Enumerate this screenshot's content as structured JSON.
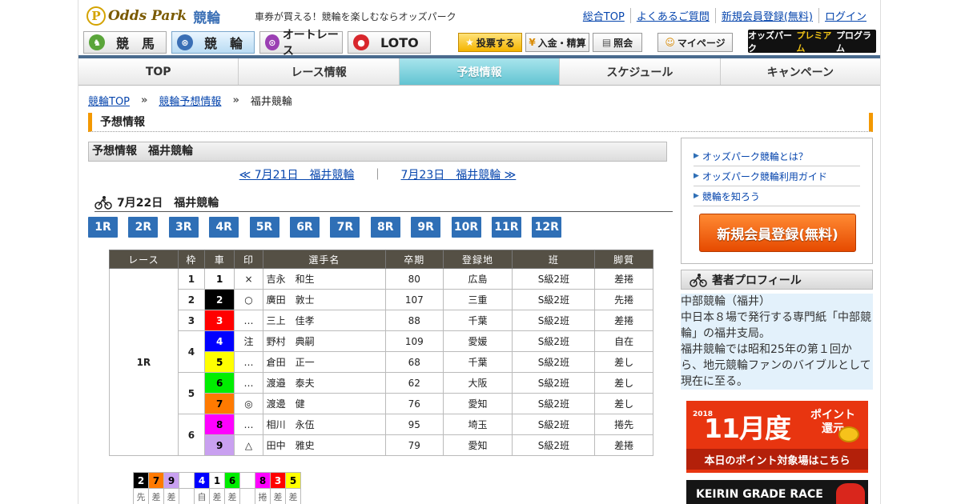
{
  "header": {
    "logo_text": "Odds Park",
    "logo_sub": "競輪",
    "tagline": "車券が買える！競輪を楽しむならオッズパーク",
    "links": [
      "総合TOP",
      "よくあるご質問",
      "新規会員登録(無料)",
      "ログイン"
    ]
  },
  "sports": [
    {
      "label": "競　馬"
    },
    {
      "label": "競　輪"
    },
    {
      "label": "オートレース"
    },
    {
      "label": "LOTO"
    }
  ],
  "user_buttons": {
    "vote": "投票する",
    "deposit": "入金・精算",
    "inquiry": "照会",
    "mypage": "マイページ"
  },
  "premium": {
    "pre": "オッズパーク",
    "mid": "プレミアム",
    "post": "プログラム"
  },
  "gnav": [
    "TOP",
    "レース情報",
    "予想情報",
    "スケジュール",
    "キャンペーン"
  ],
  "breadcrumb": {
    "items": [
      "競輪TOP",
      "競輪予想情報"
    ],
    "current": "福井競輪",
    "sep": "»"
  },
  "section_title": "予想情報",
  "subhead": "予想情報　福井競輪",
  "daynav": {
    "prev": "≪ 7月21日　福井競輪",
    "sep": "｜",
    "next": "7月23日　福井競輪 ≫"
  },
  "date_title": "7月22日　福井競輪",
  "race_tabs": [
    "1R",
    "2R",
    "3R",
    "4R",
    "5R",
    "6R",
    "7R",
    "8R",
    "9R",
    "10R",
    "11R",
    "12R"
  ],
  "table": {
    "headers": [
      "レース",
      "枠",
      "車",
      "印",
      "選手名",
      "卒期",
      "登録地",
      "班",
      "脚質"
    ],
    "race": "1R",
    "rows": [
      {
        "waku": "1",
        "car": "1",
        "mark": "×",
        "name": "吉永　和生",
        "term": "80",
        "pref": "広島",
        "class": "S級2班",
        "style": "差捲",
        "bg": "#ffffff",
        "fg": "#000000"
      },
      {
        "waku": "2",
        "car": "2",
        "mark": "○",
        "name": "廣田　敦士",
        "term": "107",
        "pref": "三重",
        "class": "S級2班",
        "style": "先捲",
        "bg": "#000000",
        "fg": "#ffffff"
      },
      {
        "waku": "3",
        "car": "3",
        "mark": "…",
        "name": "三上　佳孝",
        "term": "88",
        "pref": "千葉",
        "class": "S級2班",
        "style": "差捲",
        "bg": "#ff0000",
        "fg": "#ffffff"
      },
      {
        "waku": "4",
        "car": "4",
        "mark": "注",
        "name": "野村　典嗣",
        "term": "109",
        "pref": "愛媛",
        "class": "S級2班",
        "style": "自在",
        "bg": "#0000ff",
        "fg": "#ffffff"
      },
      {
        "waku": "",
        "car": "5",
        "mark": "…",
        "name": "倉田　正一",
        "term": "68",
        "pref": "千葉",
        "class": "S級2班",
        "style": "差し",
        "bg": "#ffff00",
        "fg": "#000000"
      },
      {
        "waku": "5",
        "car": "6",
        "mark": "…",
        "name": "渡邉　泰夫",
        "term": "62",
        "pref": "大阪",
        "class": "S級2班",
        "style": "差し",
        "bg": "#00ee00",
        "fg": "#000000"
      },
      {
        "waku": "",
        "car": "7",
        "mark": "◎",
        "name": "渡邊　健",
        "term": "76",
        "pref": "愛知",
        "class": "S級2班",
        "style": "差し",
        "bg": "#ff7a00",
        "fg": "#000000"
      },
      {
        "waku": "6",
        "car": "8",
        "mark": "…",
        "name": "相川　永伍",
        "term": "95",
        "pref": "埼玉",
        "class": "S級2班",
        "style": "捲先",
        "bg": "#ff00ff",
        "fg": "#000000"
      },
      {
        "waku": "",
        "car": "9",
        "mark": "△",
        "name": "田中　雅史",
        "term": "79",
        "pref": "愛知",
        "class": "S級2班",
        "style": "差捲",
        "bg": "#c9a0f0",
        "fg": "#000000"
      }
    ]
  },
  "line_cells": [
    {
      "car": "2",
      "bg": "#000000",
      "fg": "#ffffff",
      "s": "先"
    },
    {
      "car": "7",
      "bg": "#ff7a00",
      "fg": "#000000",
      "s": "差"
    },
    {
      "car": "9",
      "bg": "#c9a0f0",
      "fg": "#000000",
      "s": "差"
    },
    {
      "car": "",
      "bg": "#ffffff",
      "fg": "#000000",
      "s": ""
    },
    {
      "car": "4",
      "bg": "#0000ff",
      "fg": "#ffffff",
      "s": "自"
    },
    {
      "car": "1",
      "bg": "#ffffff",
      "fg": "#000000",
      "s": "差"
    },
    {
      "car": "6",
      "bg": "#00ee00",
      "fg": "#000000",
      "s": "差"
    },
    {
      "car": "",
      "bg": "#ffffff",
      "fg": "#000000",
      "s": ""
    },
    {
      "car": "8",
      "bg": "#ff00ff",
      "fg": "#000000",
      "s": "捲"
    },
    {
      "car": "3",
      "bg": "#ff0000",
      "fg": "#ffffff",
      "s": "差"
    },
    {
      "car": "5",
      "bg": "#ffff00",
      "fg": "#000000",
      "s": "差"
    }
  ],
  "sidebar": {
    "links": [
      "オッズパーク競輪とは？",
      "オッズパーク競輪利用ガイド",
      "競輪を知ろう"
    ],
    "register": "新規会員登録(無料)",
    "author_title": "著者プロフィール",
    "author_text": "中部競輪（福井）\n中日本８場で発行する専門紙「中部競輪」の福井支局。\n福井競輪では昭和25年の第１回から、地元競輪ファンのバイブルとして現在に至る。",
    "banner1": {
      "year": "2018",
      "big": "11月度",
      "pt": "ポイント\n還元",
      "bottom": "本日のポイント対象場はこちら"
    },
    "banner2": "KEIRIN GRADE RACE"
  },
  "colors": {
    "accent": "#f39800",
    "tab_blue": "#2f6fb6",
    "nav_active": "#62c4d2"
  }
}
